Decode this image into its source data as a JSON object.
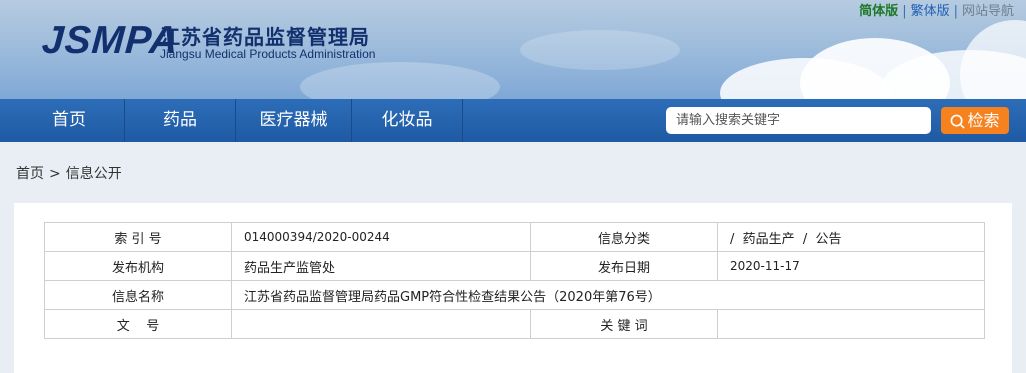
{
  "header": {
    "logo_mark": "JSMPA",
    "logo_cn": "江苏省药品监督管理局",
    "logo_en": "Jiangsu Medical Products Administration",
    "links": [
      "简体版",
      "繁体版",
      "网站导航"
    ]
  },
  "nav": {
    "items": [
      "首页",
      "药品",
      "医疗器械",
      "化妆品"
    ],
    "search_placeholder": "请输入搜索关键字",
    "search_button": "检索"
  },
  "breadcrumb": {
    "home": "首页",
    "separator": ">",
    "current": "信息公开"
  },
  "meta_table": {
    "rows": [
      [
        {
          "label": "索 引 号",
          "value": "014000394/2020-00244"
        },
        {
          "label": "信息分类",
          "value": "/  药品生产  /  公告"
        }
      ],
      [
        {
          "label": "发布机构",
          "value": "药品生产监管处"
        },
        {
          "label": "发布日期",
          "value": "2020-11-17"
        }
      ],
      [
        {
          "label": "信息名称",
          "value": "江苏省药品监督管理局药品GMP符合性检查结果公告（2020年第76号）"
        }
      ],
      [
        {
          "label": "文    号",
          "value": ""
        },
        {
          "label": "关 键 词",
          "value": ""
        }
      ]
    ]
  },
  "colors": {
    "nav_bg": "#1f5aa4",
    "search_button": "#f6821f",
    "logo": "#13306e",
    "simplified_link": "#1d7a26"
  },
  "icons": {
    "search": "search-icon"
  }
}
